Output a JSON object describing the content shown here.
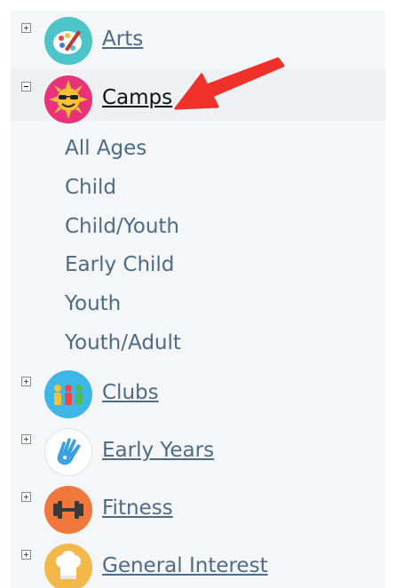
{
  "categories": [
    {
      "label": "Arts",
      "icon": "palette-icon",
      "color": "#4cc4c8",
      "expanded": false
    },
    {
      "label": "Camps",
      "icon": "sun-icon",
      "color": "#e8327a",
      "expanded": true
    },
    {
      "label": "Clubs",
      "icon": "people-icon",
      "color": "#3fb6e8",
      "expanded": false
    },
    {
      "label": "Early Years",
      "icon": "hand-icon",
      "color": "#ffffff",
      "expanded": false
    },
    {
      "label": "Fitness",
      "icon": "dumbbell-icon",
      "color": "#f0783c",
      "expanded": false
    },
    {
      "label": "General Interest",
      "icon": "chef-hat-icon",
      "color": "#f2b84a",
      "expanded": false
    }
  ],
  "camps_subcategories": [
    "All Ages",
    "Child",
    "Child/Youth",
    "Early Child",
    "Youth",
    "Youth/Adult"
  ],
  "annotation": {
    "arrow_color": "#f0302a"
  }
}
